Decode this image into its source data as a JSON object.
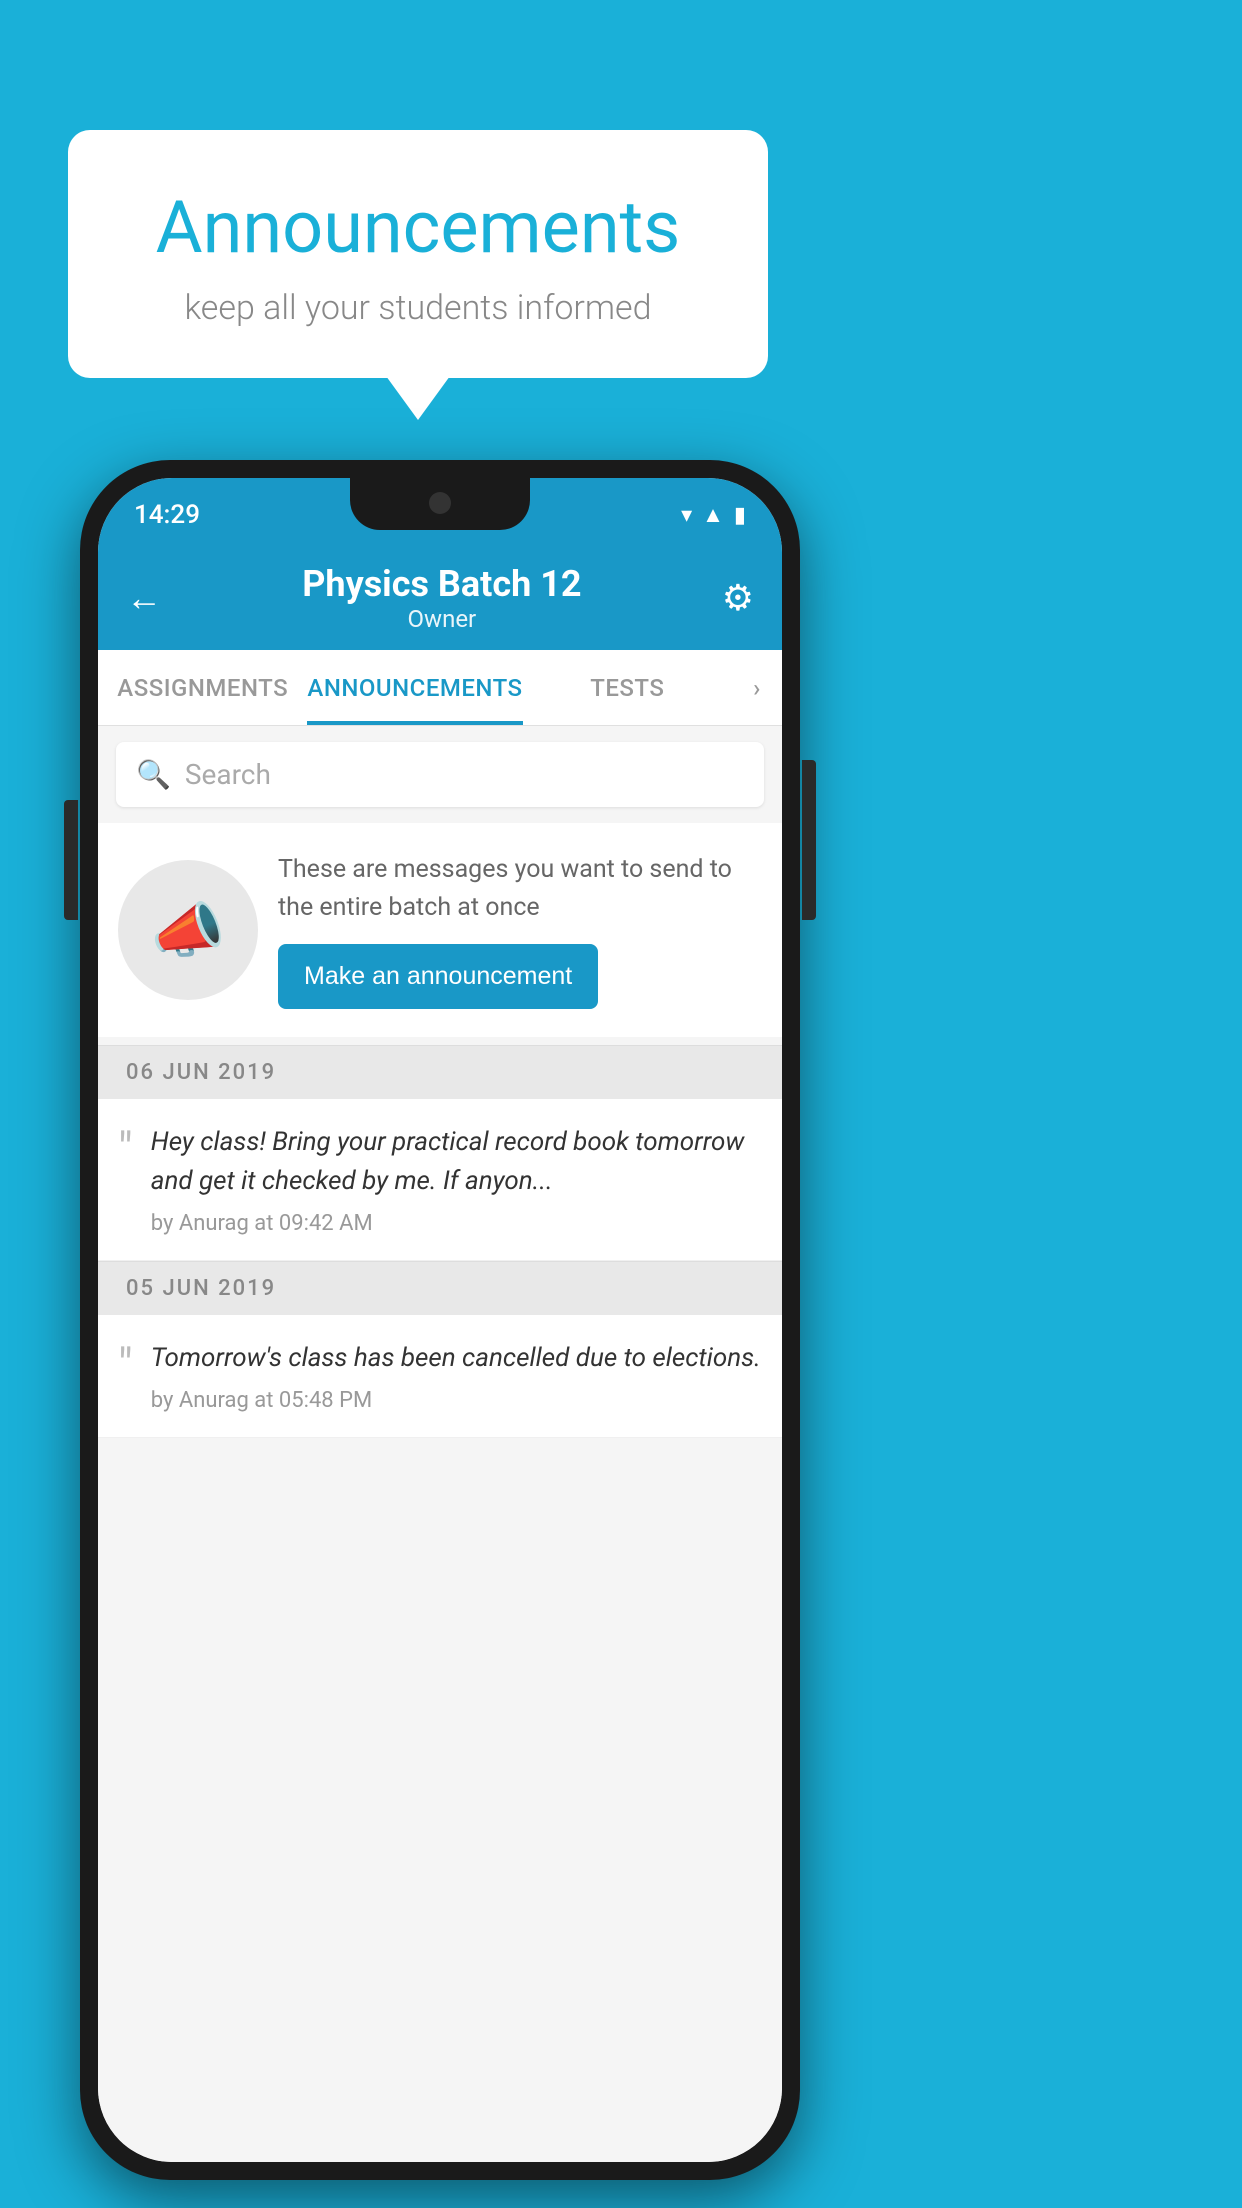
{
  "background_color": "#1ab0d8",
  "speech_bubble": {
    "title": "Announcements",
    "subtitle": "keep all your students informed"
  },
  "phone": {
    "status_bar": {
      "time": "14:29",
      "icons": [
        "wifi",
        "signal",
        "battery"
      ]
    },
    "header": {
      "back_label": "←",
      "title": "Physics Batch 12",
      "subtitle": "Owner",
      "settings_label": "⚙"
    },
    "tabs": [
      {
        "label": "ASSIGNMENTS",
        "active": false
      },
      {
        "label": "ANNOUNCEMENTS",
        "active": true
      },
      {
        "label": "TESTS",
        "active": false
      },
      {
        "label": "›",
        "active": false
      }
    ],
    "search": {
      "placeholder": "Search"
    },
    "announcement_prompt": {
      "description_text": "These are messages you want to send to the entire batch at once",
      "button_label": "Make an announcement"
    },
    "announcements": [
      {
        "date": "06  JUN  2019",
        "items": [
          {
            "text": "Hey class! Bring your practical record book tomorrow and get it checked by me. If anyon...",
            "meta": "by Anurag at 09:42 AM"
          }
        ]
      },
      {
        "date": "05  JUN  2019",
        "items": [
          {
            "text": "Tomorrow's class has been cancelled due to elections.",
            "meta": "by Anurag at 05:48 PM"
          }
        ]
      }
    ]
  }
}
